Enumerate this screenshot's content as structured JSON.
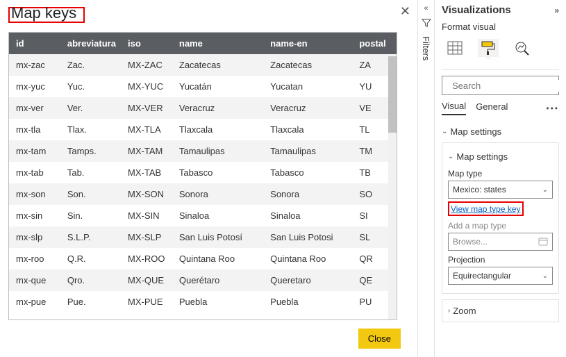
{
  "dialog": {
    "title": "Map keys",
    "close_button": "Close",
    "columns": [
      "id",
      "abreviatura",
      "iso",
      "name",
      "name-en",
      "postal"
    ],
    "rows": [
      {
        "id": "mx-zac",
        "abr": "Zac.",
        "iso": "MX-ZAC",
        "name": "Zacatecas",
        "name_en": "Zacatecas",
        "postal": "ZA"
      },
      {
        "id": "mx-yuc",
        "abr": "Yuc.",
        "iso": "MX-YUC",
        "name": "Yucatán",
        "name_en": "Yucatan",
        "postal": "YU"
      },
      {
        "id": "mx-ver",
        "abr": "Ver.",
        "iso": "MX-VER",
        "name": "Veracruz",
        "name_en": "Veracruz",
        "postal": "VE"
      },
      {
        "id": "mx-tla",
        "abr": "Tlax.",
        "iso": "MX-TLA",
        "name": "Tlaxcala",
        "name_en": "Tlaxcala",
        "postal": "TL"
      },
      {
        "id": "mx-tam",
        "abr": "Tamps.",
        "iso": "MX-TAM",
        "name": "Tamaulipas",
        "name_en": "Tamaulipas",
        "postal": "TM"
      },
      {
        "id": "mx-tab",
        "abr": "Tab.",
        "iso": "MX-TAB",
        "name": "Tabasco",
        "name_en": "Tabasco",
        "postal": "TB"
      },
      {
        "id": "mx-son",
        "abr": "Son.",
        "iso": "MX-SON",
        "name": "Sonora",
        "name_en": "Sonora",
        "postal": "SO"
      },
      {
        "id": "mx-sin",
        "abr": "Sin.",
        "iso": "MX-SIN",
        "name": "Sinaloa",
        "name_en": "Sinaloa",
        "postal": "SI"
      },
      {
        "id": "mx-slp",
        "abr": "S.L.P.",
        "iso": "MX-SLP",
        "name": "San Luis Potosí",
        "name_en": "San Luis Potosi",
        "postal": "SL"
      },
      {
        "id": "mx-roo",
        "abr": "Q.R.",
        "iso": "MX-ROO",
        "name": "Quintana Roo",
        "name_en": "Quintana Roo",
        "postal": "QR"
      },
      {
        "id": "mx-que",
        "abr": "Qro.",
        "iso": "MX-QUE",
        "name": "Querétaro",
        "name_en": "Queretaro",
        "postal": "QE"
      },
      {
        "id": "mx-pue",
        "abr": "Pue.",
        "iso": "MX-PUE",
        "name": "Puebla",
        "name_en": "Puebla",
        "postal": "PU"
      }
    ]
  },
  "filters_rail": {
    "label": "Filters"
  },
  "viz": {
    "title": "Visualizations",
    "subhead": "Format visual",
    "search_placeholder": "Search",
    "tabs": {
      "visual": "Visual",
      "general": "General"
    },
    "map_settings_label": "Map settings",
    "map_type_label": "Map type",
    "map_type_value": "Mexico: states",
    "view_key_link": "View map type key",
    "add_map_type": "Add a map type",
    "browse_placeholder": "Browse...",
    "projection_label": "Projection",
    "projection_value": "Equirectangular",
    "zoom_label": "Zoom"
  }
}
